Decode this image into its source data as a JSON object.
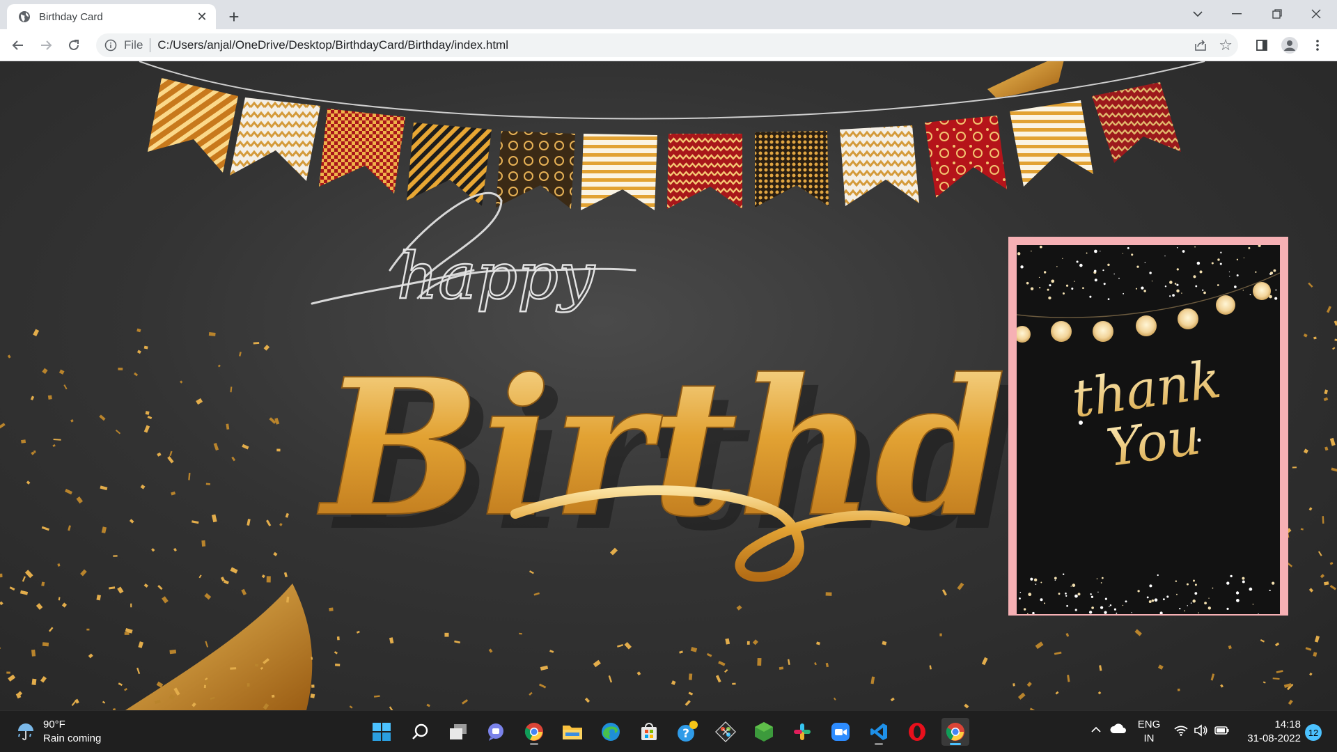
{
  "browser": {
    "tab_title": "Birthday Card",
    "url_scheme": "File",
    "url": "C:/Users/anjal/OneDrive/Desktop/BirthdayCard/Birthday/index.html"
  },
  "page": {
    "greeting_script": "happy",
    "greeting_main": "Birthday",
    "card_text_line1": "thank",
    "card_text_line2": "You",
    "card_border_color": "#f6b0b4",
    "accent_gold": "#e2a233"
  },
  "taskbar": {
    "weather_temp": "90°F",
    "weather_desc": "Rain coming",
    "lang_top": "ENG",
    "lang_bottom": "IN",
    "time": "14:18",
    "date": "31-08-2022",
    "notification_count": "12",
    "apps": [
      "start-icon",
      "search-icon",
      "task-view-icon",
      "teams-chat-icon",
      "chrome-icon",
      "file-explorer-icon",
      "edge-icon",
      "store-icon",
      "help-icon",
      "git-icon",
      "nodejs-icon",
      "slack-icon",
      "zoom-icon",
      "vscode-icon",
      "opera-icon",
      "chrome-active-icon"
    ]
  }
}
